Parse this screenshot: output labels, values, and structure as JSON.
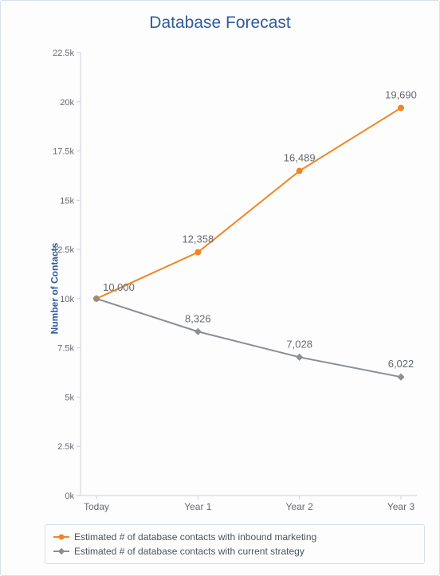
{
  "chart_data": {
    "type": "line",
    "title": "Database Forecast",
    "ylabel": "Number of Contacts",
    "categories": [
      "Today",
      "Year 1",
      "Year 2",
      "Year 3"
    ],
    "yticks": [
      0,
      2500,
      5000,
      7500,
      10000,
      12500,
      15000,
      17500,
      20000,
      22500
    ],
    "ytick_labels": [
      "0k",
      "2.5k",
      "5k",
      "7.5k",
      "10k",
      "12.5k",
      "15k",
      "17.5k",
      "20k",
      "22.5k"
    ],
    "ylim": [
      0,
      22500
    ],
    "series": [
      {
        "name": "Estimated # of database contacts with inbound marketing",
        "color": "#f08623",
        "values": [
          10000,
          12358,
          16489,
          19690
        ],
        "labels": [
          "10,000",
          "12,358",
          "16,489",
          "19,690"
        ],
        "marker": "circle"
      },
      {
        "name": "Estimated # of database contacts with current strategy",
        "color": "#8a8f94",
        "values": [
          10000,
          8326,
          7028,
          6022
        ],
        "labels": [
          "10,000",
          "8,326",
          "7,028",
          "6,022"
        ],
        "marker": "diamond"
      }
    ]
  }
}
